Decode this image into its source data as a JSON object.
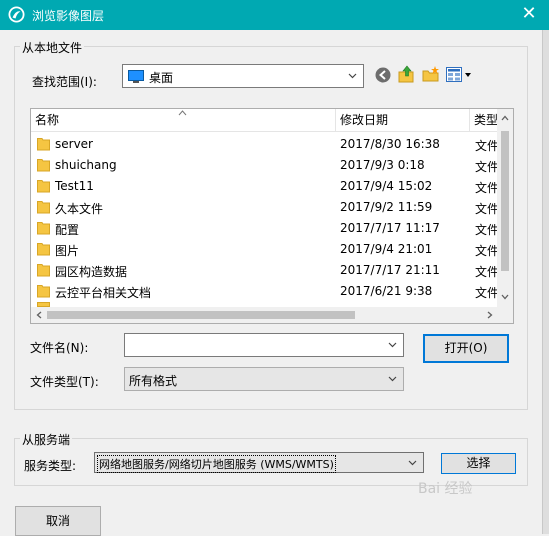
{
  "window": {
    "title": "浏览影像图层",
    "close_glyph": "✕"
  },
  "local_group": {
    "title": "从本地文件",
    "look_in_label": "查找范围(I):",
    "look_in_value": "桌面"
  },
  "columns": {
    "name": "名称",
    "date": "修改日期",
    "type": "类型"
  },
  "files": [
    {
      "name": "server",
      "date": "2017/8/30 16:38",
      "type": "文件"
    },
    {
      "name": "shuichang",
      "date": "2017/9/3 0:18",
      "type": "文件"
    },
    {
      "name": "Test11",
      "date": "2017/9/4 15:02",
      "type": "文件"
    },
    {
      "name": "久本文件",
      "date": "2017/9/2 11:59",
      "type": "文件"
    },
    {
      "name": "配置",
      "date": "2017/7/17 11:17",
      "type": "文件"
    },
    {
      "name": "图片",
      "date": "2017/9/4 21:01",
      "type": "文件"
    },
    {
      "name": "园区构造数据",
      "date": "2017/7/17 21:11",
      "type": "文件"
    },
    {
      "name": "云控平台相关文档",
      "date": "2017/6/21 9:38",
      "type": "文件"
    }
  ],
  "filename": {
    "label": "文件名(N):",
    "value": ""
  },
  "filetype": {
    "label": "文件类型(T):",
    "value": "所有格式"
  },
  "open_button": "打开(O)",
  "server_group": {
    "title": "从服务端",
    "service_label": "服务类型:",
    "service_value": "网络地图服务/网络切片地图服务 (WMS/WMTS)",
    "select_button": "选择"
  },
  "cancel_button": "取消",
  "watermark": "Bai 经验",
  "colors": {
    "titlebar": "#00a9b2",
    "folder": "#f5c542",
    "focus": "#0078d7"
  }
}
